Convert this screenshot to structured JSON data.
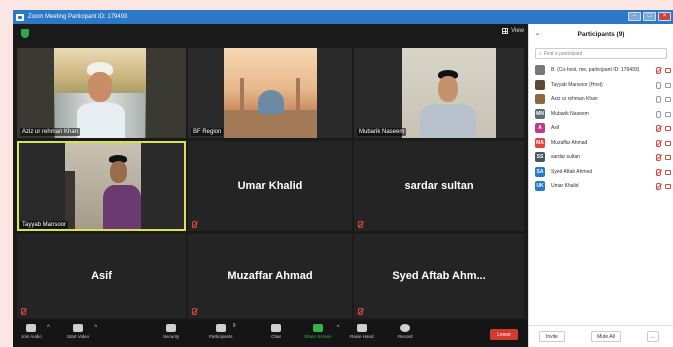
{
  "window": {
    "title": "Zoom Meeting Participant ID: 179493"
  },
  "topbar": {
    "view_label": "View"
  },
  "tiles": [
    {
      "name": "Aziz ur rehman Khan",
      "type": "video"
    },
    {
      "name": "BF Region",
      "type": "video"
    },
    {
      "name": "Mubarik Naseem",
      "type": "video"
    },
    {
      "name": "Tayyab Mansoor",
      "type": "video",
      "active": true
    },
    {
      "name": "Umar Khalid",
      "type": "name"
    },
    {
      "name": "sardar sultan",
      "type": "name"
    },
    {
      "name": "Asif",
      "type": "name"
    },
    {
      "name": "Muzaffar Ahmad",
      "type": "name"
    },
    {
      "name": "Syed Aftab Ahm...",
      "type": "name"
    }
  ],
  "toolbar": {
    "join_audio": "Join Audio",
    "start_video": "Start Video",
    "security": "Security",
    "participants": "Participants",
    "participants_count": "9",
    "chat": "Chat",
    "share_screen": "Share Screen",
    "raise_hand": "Raise Hand",
    "record": "Record",
    "leave": "Leave"
  },
  "panel": {
    "title": "Participants (9)",
    "search_placeholder": "Find a participant",
    "invite": "Invite",
    "mute_all": "Mute All",
    "more": "...",
    "participants": [
      {
        "name": "B. (Co-host, me, participant ID: 179493)",
        "initials": "",
        "color": "#777777"
      },
      {
        "name": "Tayyab Mansoor (Host)",
        "initials": "",
        "color": "#5a4a3a"
      },
      {
        "name": "Aziz ur rehman Khan",
        "initials": "",
        "color": "#8a6a3a"
      },
      {
        "name": "Mubarik Naseem",
        "initials": "MN",
        "color": "#5c6b7a"
      },
      {
        "name": "Asif",
        "initials": "A",
        "color": "#c03a8a"
      },
      {
        "name": "Muzaffar Ahmad",
        "initials": "MA",
        "color": "#e0453c"
      },
      {
        "name": "sardar sultan",
        "initials": "SS",
        "color": "#4a5560"
      },
      {
        "name": "Syed Aftab Ahmed",
        "initials": "SA",
        "color": "#2b78c9"
      },
      {
        "name": "Umar Khalid",
        "initials": "UK",
        "color": "#2b78c9"
      }
    ]
  },
  "colors": {
    "accent": "#2b78c9",
    "leave": "#d33a2f",
    "active_border": "#d7e34f",
    "share": "#35b34a"
  }
}
